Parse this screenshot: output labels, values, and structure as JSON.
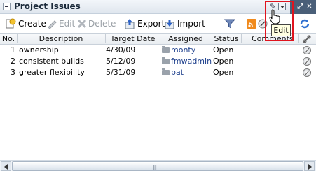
{
  "panel": {
    "title": "Project Issues",
    "tooltip": "Edit"
  },
  "toolbar": {
    "create": "Create",
    "edit": "Edit",
    "delete": "Delete",
    "export": "Export",
    "import": "Import"
  },
  "table": {
    "headers": [
      "No.",
      "Description",
      "Target Date",
      "Assigned",
      "Status",
      "Comments"
    ],
    "rows": [
      {
        "no": "1",
        "description": "ownership",
        "target_date": "4/30/09",
        "assigned": "monty",
        "status": "Open"
      },
      {
        "no": "2",
        "description": "consistent builds",
        "target_date": "5/12/09",
        "assigned": "fmwadmin",
        "status": "Open"
      },
      {
        "no": "3",
        "description": "greater flexibility",
        "target_date": "5/31/09",
        "assigned": "pat",
        "status": "Open"
      }
    ]
  },
  "scrollbar": {
    "grip": "|||"
  },
  "colors": {
    "highlight": "#e0141e",
    "link": "#1d3f8c",
    "header_dark": "#4a5f78"
  }
}
